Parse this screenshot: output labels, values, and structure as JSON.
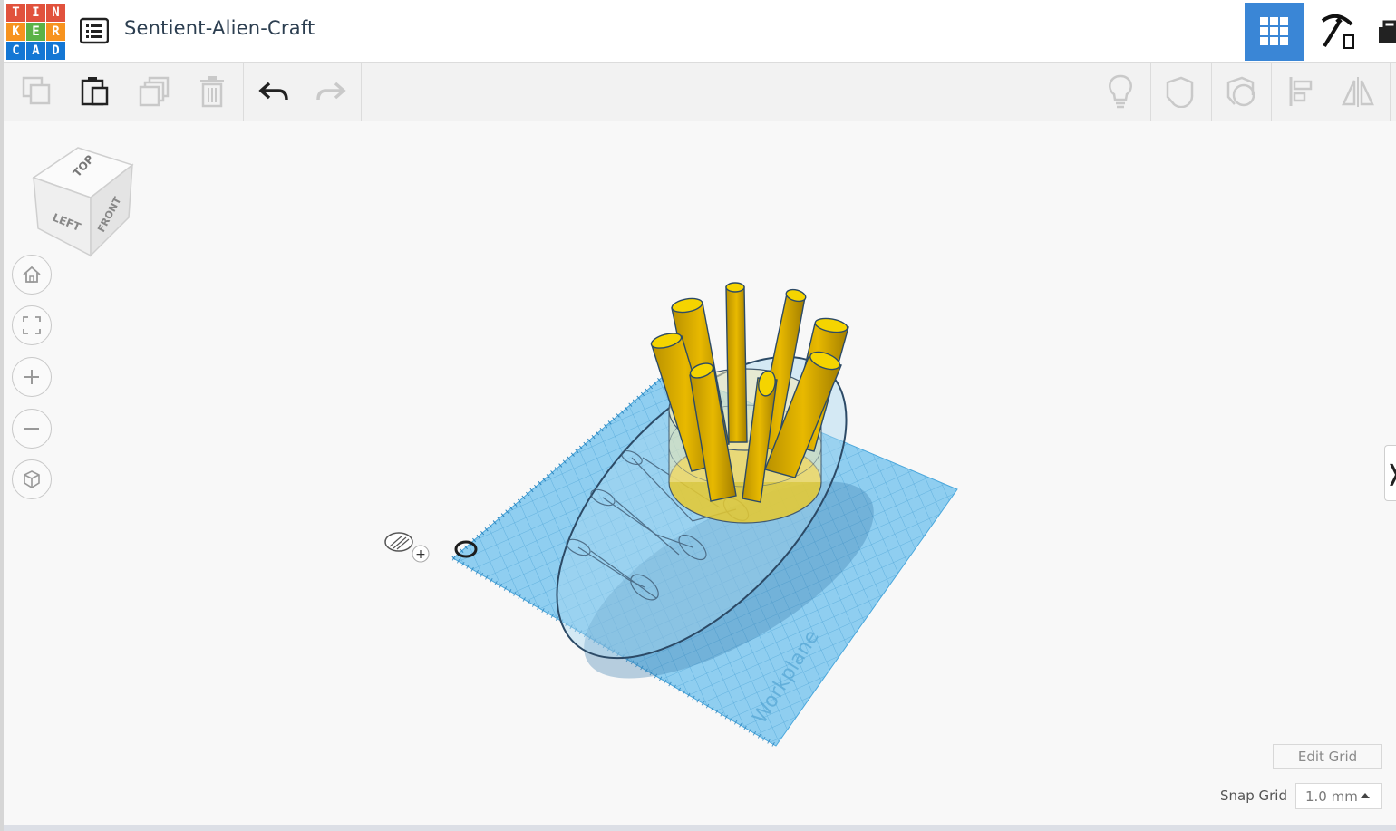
{
  "app": {
    "logo_letters": [
      "T",
      "I",
      "N",
      "K",
      "E",
      "R",
      "C",
      "A",
      "D"
    ],
    "logo_colors": [
      "#e1523d",
      "#e1523d",
      "#e1523d",
      "#f7931e",
      "#5bb247",
      "#f7931e",
      "#1477d4",
      "#1477d4",
      "#1477d4"
    ]
  },
  "header": {
    "title": "Sentient-Alien-Craft",
    "menu_icon": "list-icon",
    "view_buttons": [
      "grid-view-icon",
      "pickaxe-icon",
      "briefcase-icon"
    ],
    "accent": "#3a86d6"
  },
  "toolbar": {
    "left_tools": [
      "copy-icon",
      "paste-icon",
      "duplicate-icon",
      "delete-icon",
      "undo-icon",
      "redo-icon"
    ],
    "right_tools": [
      "lightbulb-icon",
      "shape-solid-icon",
      "shape-hole-icon",
      "align-icon",
      "mirror-icon"
    ]
  },
  "viewcube": {
    "faces": [
      "TOP",
      "LEFT",
      "FRONT"
    ]
  },
  "nav": [
    "home-icon",
    "fit-view-icon",
    "zoom-in-icon",
    "zoom-out-icon",
    "perspective-icon"
  ],
  "workplane": {
    "label": "Workplane",
    "color": "#5ab4e6"
  },
  "bottom": {
    "edit_grid": "Edit Grid",
    "snap_label": "Snap Grid",
    "snap_value": "1.0 mm"
  },
  "side_tab": {
    "label": "❭"
  }
}
